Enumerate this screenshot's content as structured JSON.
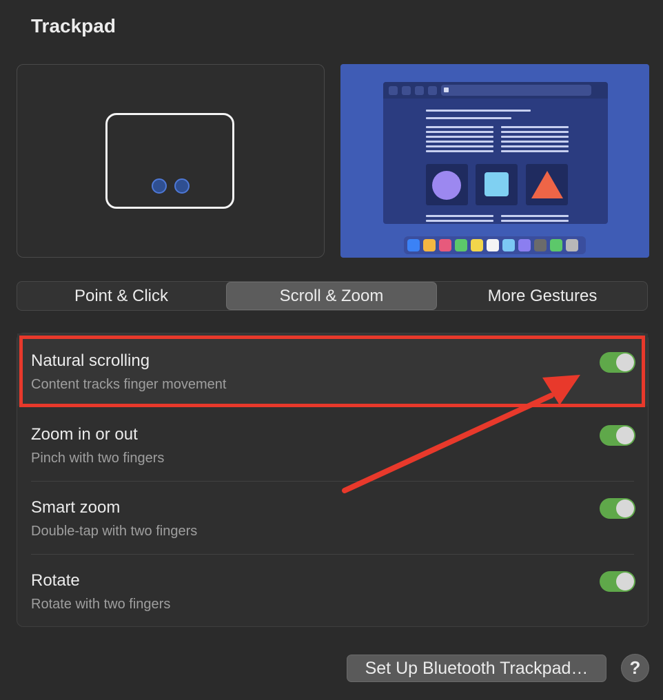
{
  "page": {
    "title": "Trackpad"
  },
  "tabs": [
    {
      "label": "Point & Click",
      "active": false
    },
    {
      "label": "Scroll & Zoom",
      "active": true
    },
    {
      "label": "More Gestures",
      "active": false
    }
  ],
  "settings": [
    {
      "label": "Natural scrolling",
      "description": "Content tracks finger movement",
      "enabled": true
    },
    {
      "label": "Zoom in or out",
      "description": "Pinch with two fingers",
      "enabled": true
    },
    {
      "label": "Smart zoom",
      "description": "Double-tap with two fingers",
      "enabled": true
    },
    {
      "label": "Rotate",
      "description": "Rotate with two fingers",
      "enabled": true
    }
  ],
  "footer": {
    "bluetooth_button": "Set Up Bluetooth Trackpad…",
    "help_label": "?"
  },
  "colors": {
    "toggle_on": "#5fa84a",
    "annotation": "#e8392b",
    "preview_bg": "#3f5cb5"
  }
}
